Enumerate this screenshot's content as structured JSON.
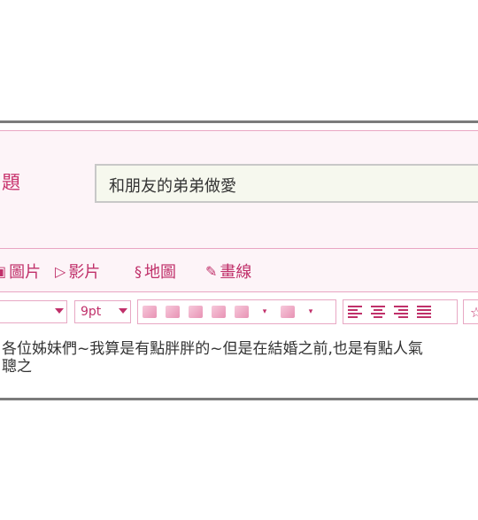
{
  "subject": {
    "label": "題",
    "value": "和朋友的弟弟做愛"
  },
  "insert_bar": {
    "image": "圖片",
    "video": "影片",
    "map": "地圖",
    "draw": "畫線"
  },
  "format_bar": {
    "font_value": "",
    "size_value": "9pt"
  },
  "body": {
    "line1": "各位姊妹們~我算是有點胖胖的~但是在結婚之前,也是有點人氣",
    "line2": "聰之"
  },
  "colors": {
    "accent": "#c0306a",
    "border": "#e9a6c3",
    "panel_bg": "#fdf4f8"
  }
}
